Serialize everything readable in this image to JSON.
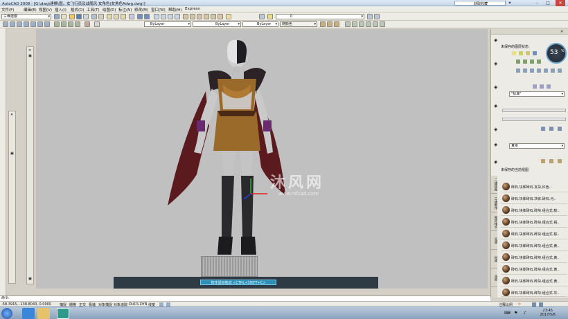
{
  "window": {
    "title": "AutoCAD 2008 - [G:\\dwg\\建模\\图，女飞行员及战舰风   女角色(女角色Adwg.dwg)]",
    "search_placeholder": "",
    "subtitle_right": "获取收藏"
  },
  "menubar": {
    "items": [
      "文件(F)",
      "编辑(E)",
      "视图(V)",
      "插入(I)",
      "格式(O)",
      "工具(T)",
      "绘图(D)",
      "标注(N)",
      "修改(M)",
      "窗口(W)",
      "帮助(H)",
      "Express"
    ]
  },
  "toolbar1": {
    "workspace": "三维建模",
    "layer": "0"
  },
  "toolbar2": {
    "color": "ByLayer",
    "linetype": "ByLayer",
    "lineweight": "ByLayer",
    "plotstyle": "随颜色"
  },
  "viewport": {
    "navigate_button": "按住鼠标拖动 <CTRL+SHIFT+C>",
    "watermark_main": "沐风网",
    "watermark_sub": "www.mfcad.com"
  },
  "right_panel": {
    "layer_header": "未保存的图层状态",
    "style_combo": "\"标准\"",
    "visual_combo": "真实",
    "view_header": "未保存的当前视图",
    "materials": [
      "砖石.块体砖石.瓦块.红色..",
      "砖石.块体砖石.块体.砖石.污..",
      "砖石.块体砖石.砖块.组合式.棕..",
      "砖石.块体砖石.砖块.组合式.褐..",
      "砖石.块体砖石.砖块.组合式.棕..",
      "砖石.块体砖石.砖块.组合式.黄..",
      "砖石.块体砖石.砖块.组合式.黄..",
      "砖石.块体砖石.砖块.组合式.黄..",
      "砖石.块体砖石.砖块.组合式.黄..",
      "砖石.块体砖石.砖块.组合式.灰.."
    ],
    "tabs": [
      "二维绘图",
      "三维制作",
      "视觉样式",
      "光源",
      "材质",
      "渲染"
    ]
  },
  "perf_gauge": {
    "value": "53",
    "unit": "%"
  },
  "command_line": {
    "prompt": "命令:"
  },
  "statusbar": {
    "coords": "-58.3915, -138.8043, 0.0000",
    "toggles": [
      "捕捉",
      "栅格",
      "正交",
      "极轴",
      "对象捕捉",
      "对象追踪",
      "DUCS",
      "DYN",
      "线宽"
    ],
    "annotation": "注释比例"
  },
  "taskbar": {
    "time": "23:45",
    "date": "2017/5/6"
  }
}
